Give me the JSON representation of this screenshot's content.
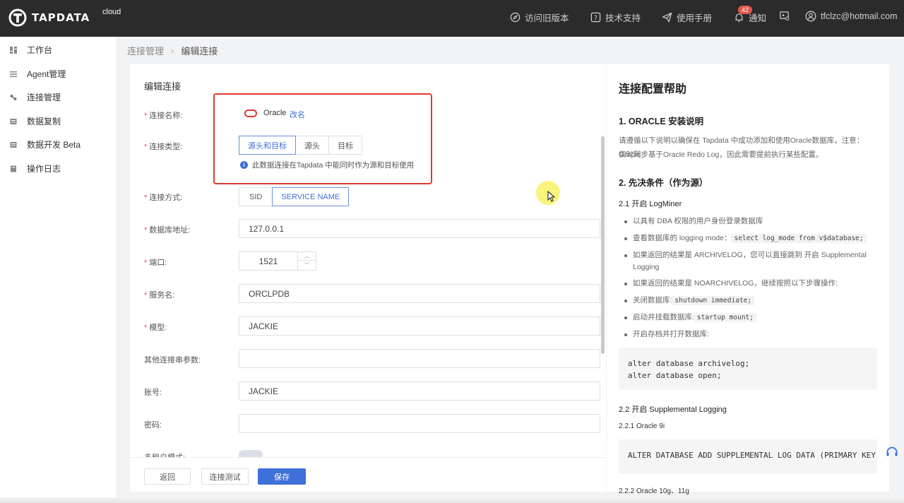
{
  "topbar": {
    "logo_text": "TAPDATA",
    "logo_sub": "cloud",
    "old_version": "访问旧版本",
    "support": "技术支持",
    "manual": "使用手册",
    "notify": "通知",
    "notify_count": "42",
    "user_email": "tfclzc@hotmail.com"
  },
  "sidebar": {
    "items": [
      {
        "label": "工作台"
      },
      {
        "label": "Agent管理"
      },
      {
        "label": "连接管理"
      },
      {
        "label": "数据复制"
      },
      {
        "label": "数据开发 Beta"
      },
      {
        "label": "操作日志"
      }
    ]
  },
  "breadcrumb": {
    "parent": "连接管理",
    "current": "编辑连接"
  },
  "form": {
    "title": "编辑连接",
    "name_label": "连接名称:",
    "name_value": "Oracle",
    "rename": "改名",
    "type_label": "连接类型:",
    "type_options": [
      "源头和目标",
      "源头",
      "目标"
    ],
    "type_info": "此数据连接在Tapdata 中能同时作为源和目标使用",
    "mode_label": "连接方式:",
    "mode_options": [
      "SID",
      "SERVICE NAME"
    ],
    "host_label": "数据库地址:",
    "host_value": "127.0.0.1",
    "port_label": "端口:",
    "port_value": "1521",
    "service_label": "服务名:",
    "service_value": "ORCLPDB",
    "schema_label": "模型:",
    "schema_value": "JACKIE",
    "extra_label": "其他连接串参数:",
    "extra_value": "",
    "account_label": "账号:",
    "account_value": "JACKIE",
    "password_label": "密码:",
    "password_value": "",
    "multitenant_label": "多租户模式:"
  },
  "footer": {
    "back": "返回",
    "test": "连接测试",
    "save": "保存"
  },
  "help": {
    "title": "连接配置帮助",
    "s1": "1. ORACLE 安装说明",
    "p1a": "请遵循以下说明以确保在 Tapdata 中成功添加和使用Oracle数据库，注意：Oracle",
    "p1b": "实时同步基于Oracle Redo Log，因此需要提前执行某些配置。",
    "s2": "2. 先决条件（作为源）",
    "s21": "2.1 开启 LogMiner",
    "b1": "以具有 DBA 权限的用户身份登录数据库",
    "b2_text": "查看数据库的 logging mode：",
    "b2_code": "select log_mode from v$database;",
    "b3": "如果返回的结果是 ARCHIVELOG，您可以直接跳到 开启 Supplemental Logging",
    "b4": "如果返回的结果是 NOARCHIVELOG，继续按照以下步骤操作:",
    "b5_text": "关闭数据库:",
    "b5_code": "shutdown immediate;",
    "b6_text": "启动并挂载数据库:",
    "b6_code": "startup mount;",
    "b7": "开启存档并打开数据库:",
    "code1": "alter database archivelog;\nalter database open;",
    "s22": "2.2 开启 Supplemental Logging",
    "s221": "2.2.1 Oracle 9i",
    "code2": "ALTER DATABASE ADD SUPPLEMENTAL LOG DATA (PRIMARY KEY) COLUMNS;",
    "s222": "2.2.2 Oracle 10g、11g"
  }
}
